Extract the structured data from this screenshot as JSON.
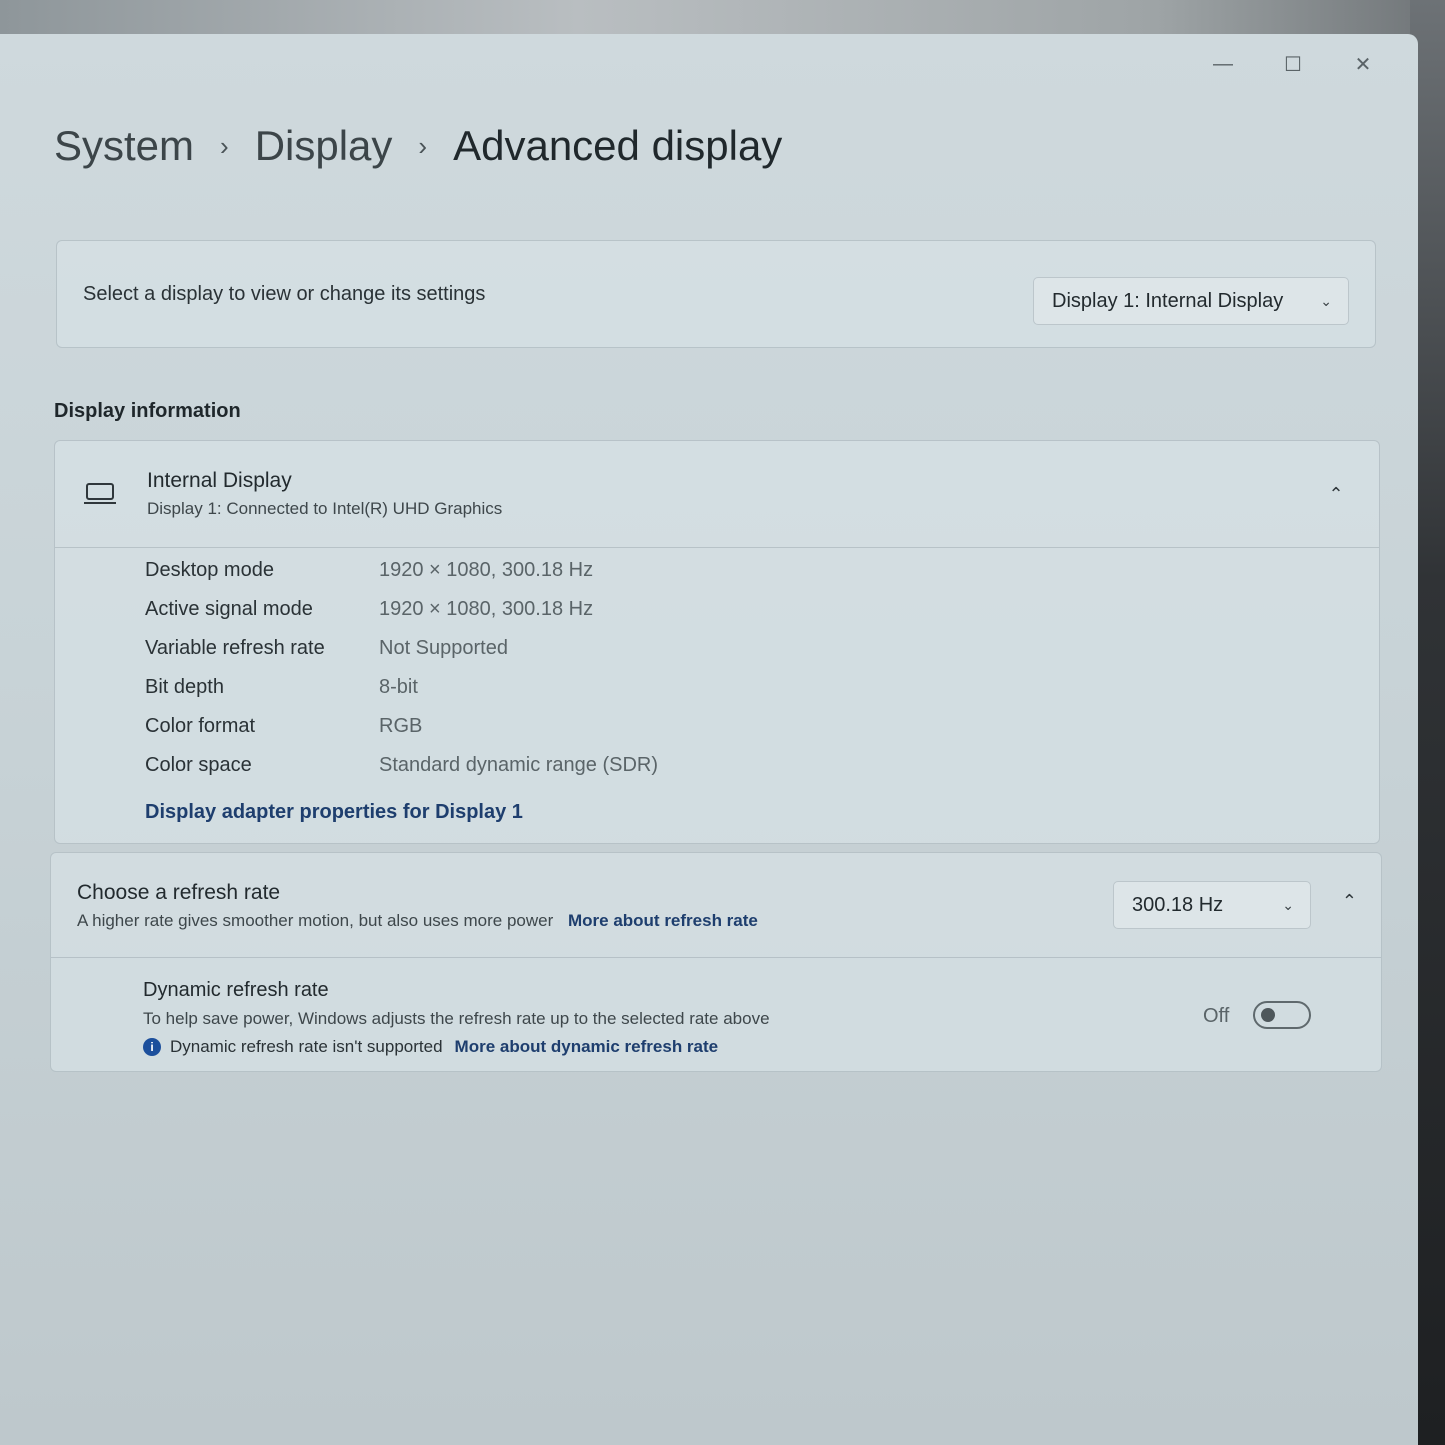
{
  "window": {
    "controls": {
      "minimize": "—",
      "maximize": "☐",
      "close": "✕"
    }
  },
  "breadcrumb": {
    "items": [
      "System",
      "Display",
      "Advanced display"
    ],
    "separator": "›"
  },
  "select_display": {
    "label": "Select a display to view or change its settings",
    "dropdown_value": "Display 1: Internal Display"
  },
  "display_information": {
    "section_title": "Display information",
    "display_name": "Internal Display",
    "display_subtitle": "Display 1: Connected to Intel(R) UHD Graphics",
    "properties": [
      {
        "key": "Desktop mode",
        "value": "1920 × 1080, 300.18 Hz"
      },
      {
        "key": "Active signal mode",
        "value": "1920 × 1080, 300.18 Hz"
      },
      {
        "key": "Variable refresh rate",
        "value": "Not Supported"
      },
      {
        "key": "Bit depth",
        "value": "8-bit"
      },
      {
        "key": "Color format",
        "value": "RGB"
      },
      {
        "key": "Color space",
        "value": "Standard dynamic range (SDR)"
      }
    ],
    "adapter_link": "Display adapter properties for Display 1"
  },
  "refresh_rate": {
    "title": "Choose a refresh rate",
    "subtitle": "A higher rate gives smoother motion, but also uses more power",
    "link": "More about refresh rate",
    "dropdown_value": "300.18 Hz",
    "dynamic": {
      "title": "Dynamic refresh rate",
      "subtitle": "To help save power, Windows adjusts the refresh rate up to the selected rate above",
      "note_icon": "i",
      "note": "Dynamic refresh rate isn't supported",
      "note_link": "More about dynamic refresh rate",
      "toggle_state": "Off"
    }
  },
  "colors": {
    "accent_link": "#1e3e6e",
    "info_icon": "#1c4f9c"
  }
}
